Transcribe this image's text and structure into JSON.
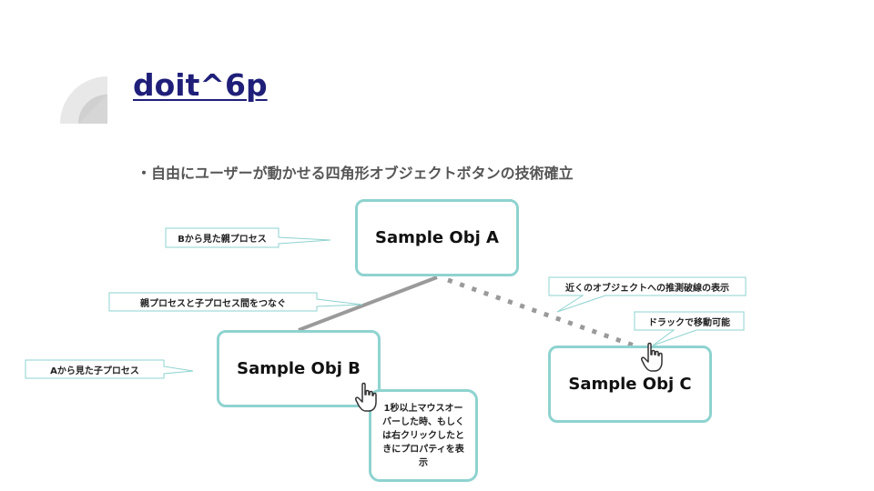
{
  "title": "doit^6p",
  "bullet": "・自由にユーザーが動かせる四角形オブジェクトボタンの技術確立",
  "objects": {
    "a": "Sample Obj A",
    "b": "Sample Obj B",
    "c": "Sample Obj C"
  },
  "callouts": {
    "parent_from_b": "Bから見た親プロセス",
    "connect": "親プロセスと子プロセス間をつなぐ",
    "child_from_a": "Aから見た子プロセス",
    "guess_line": "近くのオブジェクトへの推測破線の表示",
    "drag": "ドラックで移動可能"
  },
  "tooltip": "1秒以上マウスオーバーした時、もしくは右クリックしたときにプロパティを表示",
  "icons": [
    "hand-cursor-icon"
  ],
  "colors": {
    "accent": "#8ed3d0",
    "title": "#1f1f7a",
    "connector": "#999999",
    "deco": "#e6e6e6"
  }
}
